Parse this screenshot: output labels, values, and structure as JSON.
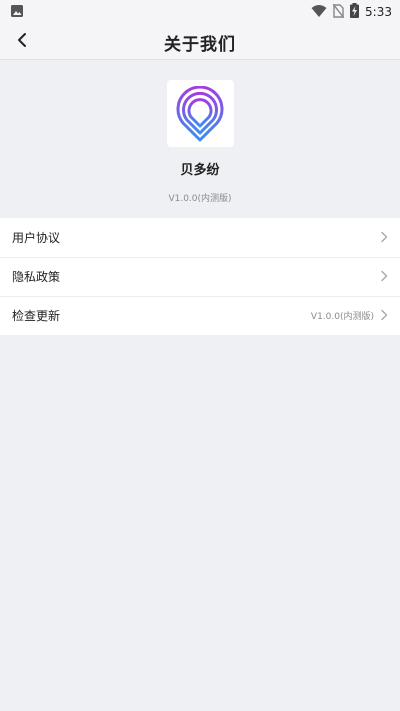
{
  "status_bar": {
    "time": "5:33",
    "icons": [
      "image-icon",
      "wifi-icon",
      "no-sim-icon",
      "battery-charging-icon"
    ]
  },
  "nav": {
    "title": "关于我们",
    "back_icon": "chevron-left-icon"
  },
  "about": {
    "app_name": "贝多纷",
    "version": "V1.0.0(内测版)",
    "logo_colors": [
      "#a23de0",
      "#3a8ef0"
    ]
  },
  "menu": {
    "items": [
      {
        "label": "用户协议",
        "value": ""
      },
      {
        "label": "隐私政策",
        "value": ""
      },
      {
        "label": "检查更新",
        "value": "V1.0.0(内测版)"
      }
    ]
  },
  "colors": {
    "background": "#eff0f4",
    "card": "#ffffff",
    "text_primary": "#222222",
    "text_secondary": "#8a8a8a"
  }
}
